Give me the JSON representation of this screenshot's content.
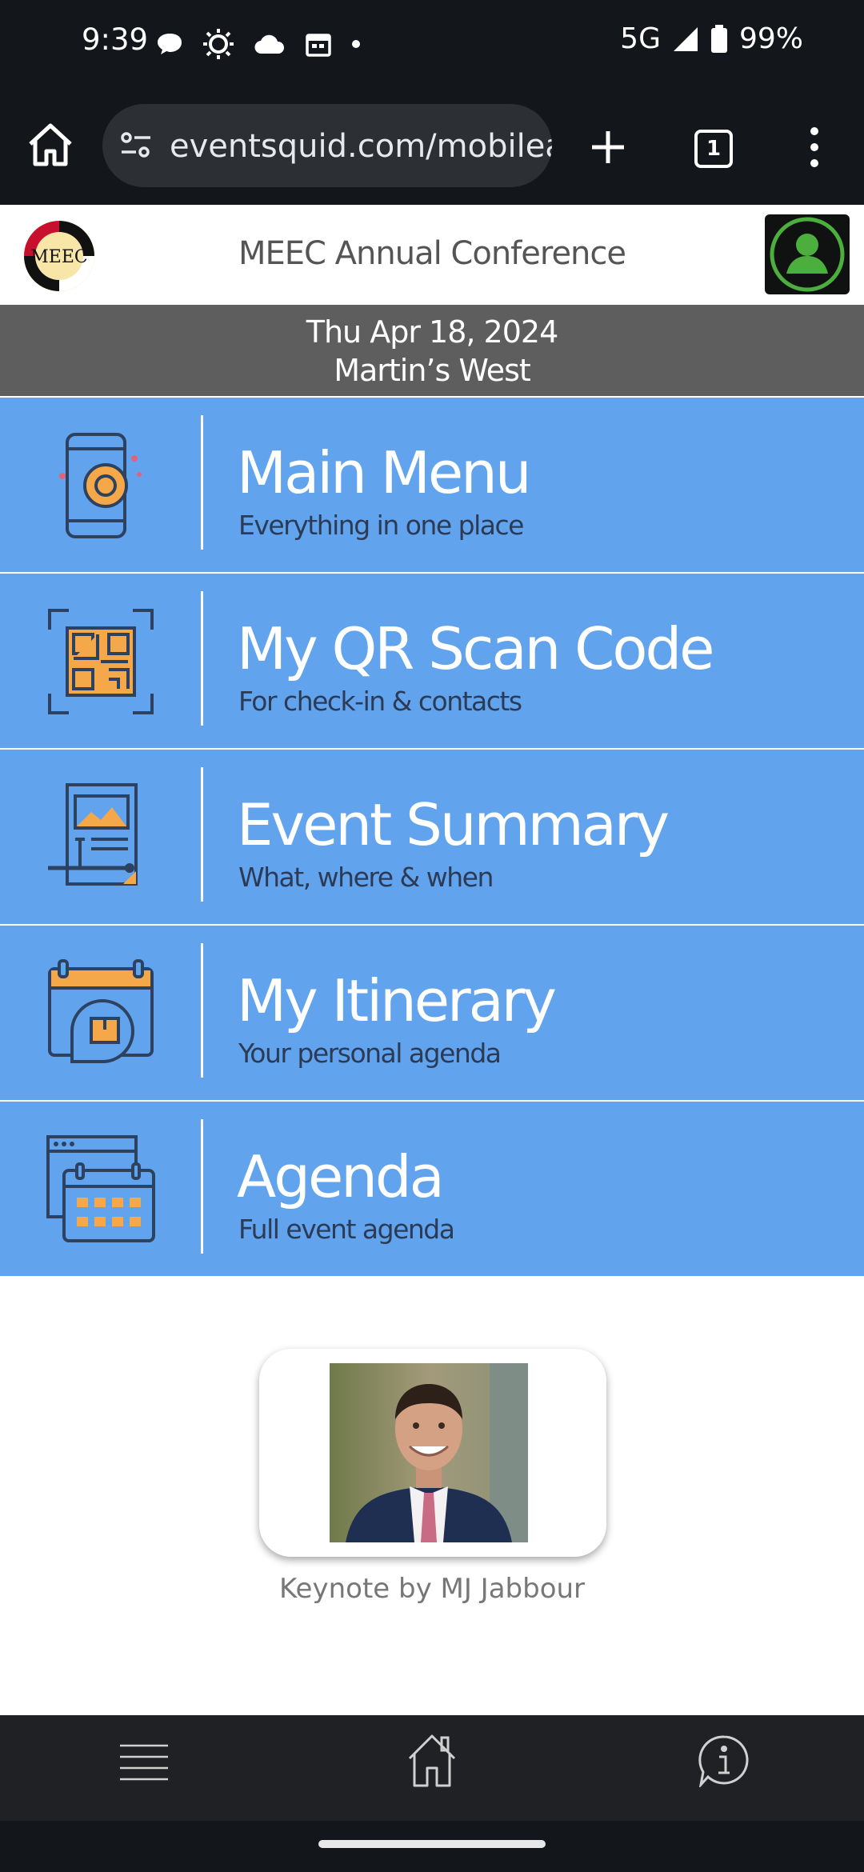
{
  "status_bar": {
    "time": "9:39",
    "network": "5G",
    "battery": "99%",
    "icons": [
      "chat-bubble-icon",
      "brightness-icon",
      "cloud-icon",
      "calendar-icon",
      "dot-icon",
      "signal-icon",
      "battery-icon"
    ]
  },
  "browser": {
    "url": "eventsquid.com/mobilea",
    "tab_count": "1"
  },
  "app": {
    "title": "MEEC Annual Conference",
    "logo_text": "MEEC",
    "date": "Thu Apr 18, 2024",
    "venue": "Martin’s West"
  },
  "tiles": [
    {
      "title": "Main Menu",
      "subtitle": "Everything in one place",
      "icon": "phone-camera-icon"
    },
    {
      "title": "My QR Scan Code",
      "subtitle": "For check-in & contacts",
      "icon": "qr-code-icon"
    },
    {
      "title": "Event Summary",
      "subtitle": "What, where & when",
      "icon": "document-icon"
    },
    {
      "title": "My Itinerary",
      "subtitle": "Your personal agenda",
      "icon": "calendar-package-icon"
    },
    {
      "title": "Agenda",
      "subtitle": "Full event agenda",
      "icon": "calendar-grid-icon"
    }
  ],
  "keynote": {
    "caption": "Keynote by MJ Jabbour"
  },
  "colors": {
    "tile_bg": "#62a3ee",
    "header_band": "#5e5e5e",
    "system_bar": "#13161b",
    "bottom_nav": "#202124",
    "icon_orange": "#f4a84a",
    "icon_dark": "#2d4160"
  },
  "bottom_nav": {
    "items": [
      "menu-icon",
      "home-icon",
      "info-icon"
    ]
  }
}
